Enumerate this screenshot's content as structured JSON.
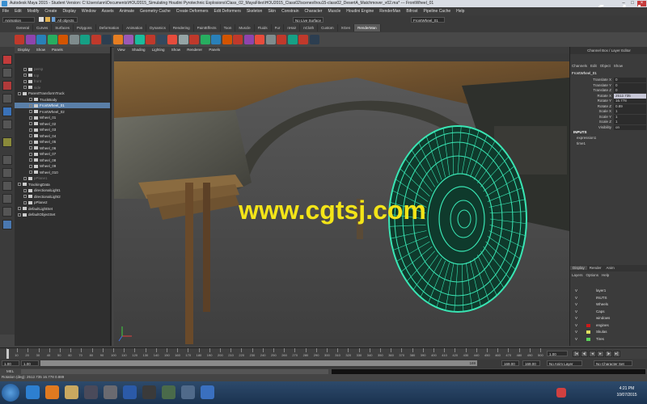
{
  "window": {
    "title": "Autodesk Maya 2015 - Student Version: C:\\Users\\ann\\Documents\\HOU2015_Simulating Houdini Pyrotechnic Explosions\\Class_02_MayaFiles\\HOU2015_Class02\\scenes\\hou15-class02_DesertA_Matchmover_v02.ma* --- FrontWheel_01",
    "watermark_logo": "fxphd"
  },
  "menubar": [
    "File",
    "Edit",
    "Modify",
    "Create",
    "Display",
    "Window",
    "Assets",
    "Animate",
    "Geometry Cache",
    "Create Deformers",
    "Edit Deformers",
    "Skeleton",
    "Skin",
    "Constrain",
    "Character",
    "Muscle",
    "Houdini Engine",
    "RenderMan",
    "Bifrost",
    "Pipeline Cache",
    "Help"
  ],
  "statusline": {
    "mode": "Animation",
    "selection_mask": "All objects",
    "live_surface": "No Live Surface",
    "name_field": "FrontWheel_01"
  },
  "shelf_tabs": [
    "General",
    "Curves",
    "Surfaces",
    "Polygons",
    "Deformation",
    "Animation",
    "Dynamics",
    "Rendering",
    "PaintEffects",
    "Toon",
    "Muscle",
    "Fluids",
    "Fur",
    "nHair",
    "nCloth",
    "Custom",
    "XGen",
    "RenderMan"
  ],
  "shelf_active": "RenderMan",
  "outliner": {
    "menu": [
      "Display",
      "Show",
      "Panels"
    ],
    "items": [
      {
        "label": "persp",
        "depth": 1,
        "dim": true
      },
      {
        "label": "top",
        "depth": 1,
        "dim": true
      },
      {
        "label": "front",
        "depth": 1,
        "dim": true
      },
      {
        "label": "side",
        "depth": 1,
        "dim": true
      },
      {
        "label": "ParentTransformTruck",
        "depth": 0
      },
      {
        "label": "TruckBody",
        "depth": 2
      },
      {
        "label": "FrontWheel_01",
        "depth": 2,
        "selected": true
      },
      {
        "label": "FrontWheel_02",
        "depth": 2
      },
      {
        "label": "Wheel_01",
        "depth": 2
      },
      {
        "label": "Wheel_02",
        "depth": 2
      },
      {
        "label": "Wheel_03",
        "depth": 2
      },
      {
        "label": "Wheel_04",
        "depth": 2
      },
      {
        "label": "Wheel_05",
        "depth": 2
      },
      {
        "label": "Wheel_06",
        "depth": 2
      },
      {
        "label": "Wheel_07",
        "depth": 2
      },
      {
        "label": "Wheel_08",
        "depth": 2
      },
      {
        "label": "Wheel_09",
        "depth": 2
      },
      {
        "label": "Wheel_010",
        "depth": 2
      },
      {
        "label": "pPlane1",
        "depth": 1,
        "dim": true
      },
      {
        "label": "TrackingData",
        "depth": 0
      },
      {
        "label": "directionalLight1",
        "depth": 1
      },
      {
        "label": "directionalLight2",
        "depth": 1
      },
      {
        "label": "pPlane2",
        "depth": 1
      },
      {
        "label": "defaultLightSet",
        "depth": 0
      },
      {
        "label": "defaultObjectSet",
        "depth": 0
      }
    ]
  },
  "viewport": {
    "menu": [
      "View",
      "Shading",
      "Lighting",
      "Show",
      "Renderer",
      "Panels"
    ],
    "overlay_text": "www.cgtsj.com"
  },
  "channelbox": {
    "header": "Channel Box / Layer Editor",
    "menu": [
      "Channels",
      "Edit",
      "Object",
      "Show"
    ],
    "object": "FrontWheel_01",
    "attributes": [
      {
        "name": "Translate X",
        "value": "0"
      },
      {
        "name": "Translate Y",
        "value": "0"
      },
      {
        "name": "Translate Z",
        "value": "0"
      },
      {
        "name": "Rotate X",
        "value": "2512.735",
        "highlight": true
      },
      {
        "name": "Rotate Y",
        "value": "16.778"
      },
      {
        "name": "Rotate Z",
        "value": "0.89"
      },
      {
        "name": "Scale X",
        "value": "1"
      },
      {
        "name": "Scale Y",
        "value": "1"
      },
      {
        "name": "Scale Z",
        "value": "1"
      },
      {
        "name": "Visibility",
        "value": "on"
      }
    ],
    "inputs_label": "INPUTS",
    "inputs": [
      "expression1",
      "time1"
    ]
  },
  "layers": {
    "tabs": [
      "Display",
      "Render",
      "Anim"
    ],
    "menu": [
      "Layers",
      "Options",
      "Help"
    ],
    "rows": [
      {
        "label": "layer1",
        "color": ""
      },
      {
        "label": "INUTS",
        "color": ""
      },
      {
        "label": "Wheels",
        "color": ""
      },
      {
        "label": "Caps",
        "color": ""
      },
      {
        "label": "windows",
        "color": ""
      },
      {
        "label": "engines",
        "color": "#cc1a1a"
      },
      {
        "label": "Skulas",
        "color": "#e0e060"
      },
      {
        "label": "Tires",
        "color": "#5ad25a"
      }
    ]
  },
  "timeline": {
    "ticks": [
      "1",
      "10",
      "20",
      "30",
      "40",
      "50",
      "60",
      "70",
      "80",
      "90",
      "100",
      "110",
      "120",
      "130",
      "140",
      "150",
      "160",
      "170",
      "180",
      "190",
      "200",
      "210",
      "220",
      "230",
      "240",
      "250",
      "260",
      "270",
      "280",
      "290",
      "300",
      "310",
      "320",
      "330",
      "340",
      "350",
      "360",
      "370",
      "380",
      "390",
      "400",
      "410",
      "420",
      "430",
      "440",
      "450",
      "460",
      "470",
      "480",
      "490",
      "500"
    ],
    "current_frame": "1.00",
    "range_start": "1.00",
    "range_start2": "1.00",
    "range_end": "169",
    "range_end_field": "169.00",
    "range_end_field2": "169.00",
    "anim_layer": "No Anim Layer",
    "char_set": "No Character Set"
  },
  "commandline": {
    "lang": "MEL",
    "help": "Rotation (deg):  2512.735   16.778   0.889"
  },
  "taskbar": {
    "time": "4:21 PM",
    "date": "10/07/2015"
  },
  "colors": {
    "wheel_wire": "#39e6b4",
    "selection": "#5a7fa8",
    "watermark": "#f3e418"
  }
}
